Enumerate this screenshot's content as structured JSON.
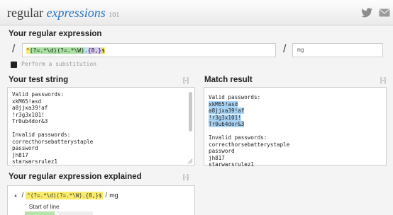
{
  "header": {
    "logo_regular": "regular",
    "logo_expressions": "expressions",
    "logo_version": "101"
  },
  "regex": {
    "title": "Your regular expression",
    "delimiter": "/",
    "pattern": "^(?=.*\\d)(?=.*\\W).{8,}$",
    "pattern_parts": [
      "^",
      "(?=.*\\d)",
      "(?=.*\\W)",
      ".",
      "{8,}",
      "$"
    ],
    "flags": "mg"
  },
  "substitution": {
    "label": "Perform a substitution",
    "checked": true
  },
  "test_string": {
    "title": "Your test string",
    "collapse": "[-]",
    "lines": [
      "Valid passwords:",
      "xkM65!asd",
      "a8jjxa39!af",
      "!r3g3x101!",
      "Tr0ub4dor&3",
      "",
      "Invalid passwords:",
      "correcthorsebatterystaple",
      "password",
      "jh817",
      "starwarsrulez1"
    ]
  },
  "match_result": {
    "title": "Match result",
    "collapse": "[-]",
    "lines": [
      {
        "text": "Valid passwords:",
        "match": false
      },
      {
        "text": "xkM65!asd",
        "match": true
      },
      {
        "text": "a8jjxa39!af",
        "match": true
      },
      {
        "text": "!r3g3x101!",
        "match": true
      },
      {
        "text": "Tr0ub4dor&3",
        "match": true
      },
      {
        "text": "",
        "match": false
      },
      {
        "text": "Invalid passwords:",
        "match": false
      },
      {
        "text": "correcthorsebatterystaple",
        "match": false
      },
      {
        "text": "password",
        "match": false
      },
      {
        "text": "jh817",
        "match": false
      },
      {
        "text": "starwarsrulez1",
        "match": false
      }
    ]
  },
  "explained": {
    "title": "Your regular expression explained",
    "collapse": "[-]",
    "pattern": "^(?=.*\\d)(?=.*\\W).{8,}$",
    "flags": "mg",
    "first_item": "Start of line"
  },
  "icons": {
    "twitter": "twitter-bird-icon",
    "mail": "envelope-icon"
  },
  "colors": {
    "match_highlight": "#a9d4f5",
    "anchor": "#f9ec6c",
    "lookahead": "#a8e0a0",
    "quantifier": "#d6c8ee",
    "logo_accent": "#2b78c2"
  }
}
